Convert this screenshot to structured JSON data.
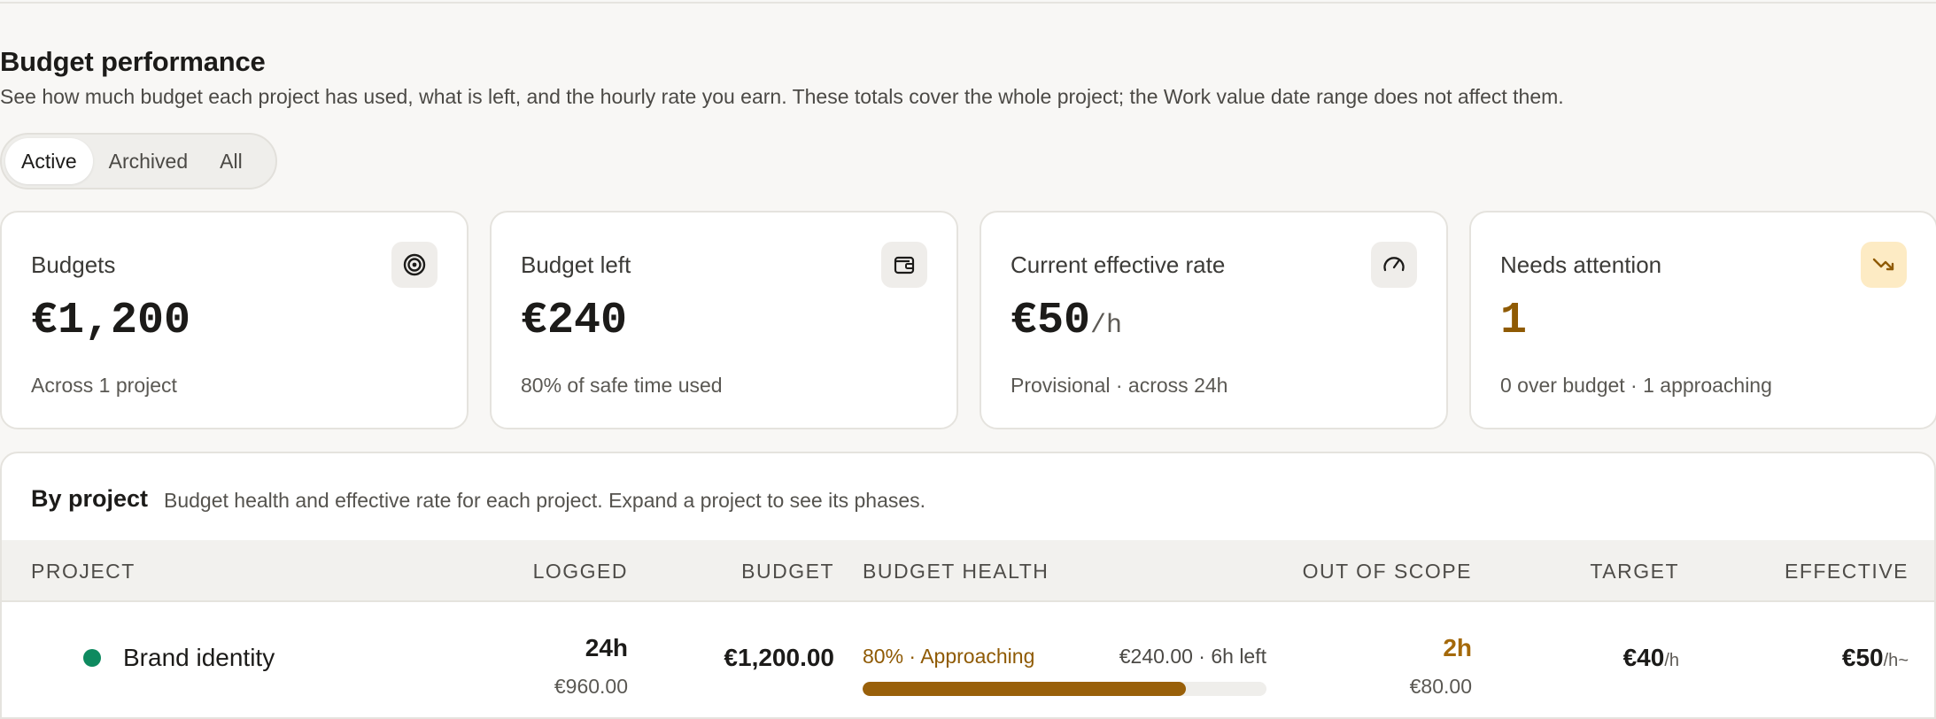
{
  "header": {
    "title": "Budget performance",
    "description": "See how much budget each project has used, what is left, and the hourly rate you earn. These totals cover the whole project; the Work value date range does not affect them."
  },
  "filter_tabs": [
    "Active",
    "Archived",
    "All"
  ],
  "filter_selected": "Active",
  "cards": [
    {
      "label": "Budgets",
      "value": "€1,200",
      "unit": "",
      "sub": "Across 1 project",
      "icon": "target-icon"
    },
    {
      "label": "Budget left",
      "value": "€240",
      "unit": "",
      "sub": "80% of safe time used",
      "icon": "wallet-icon"
    },
    {
      "label": "Current effective rate",
      "value": "€50",
      "unit": "/h",
      "sub": "Provisional · across 24h",
      "icon": "gauge-icon"
    },
    {
      "label": "Needs attention",
      "value": "1",
      "unit": "",
      "sub": "0 over budget · 1 approaching",
      "icon": "trending-down-icon"
    }
  ],
  "by_project": {
    "title": "By project",
    "description": "Budget health and effective rate for each project. Expand a project to see its phases.",
    "columns": [
      "PROJECT",
      "LOGGED",
      "BUDGET",
      "BUDGET HEALTH",
      "OUT OF SCOPE",
      "TARGET",
      "EFFECTIVE"
    ],
    "rows": [
      {
        "name": "Brand identity",
        "logged_hours": "24h",
        "logged_value": "€960.00",
        "budget": "€1,200.00",
        "health_label": "80% · Approaching",
        "health_left": "€240.00 · 6h left",
        "health_percent": 80,
        "out_of_scope_hours": "2h",
        "out_of_scope_value": "€80.00",
        "target": "€40",
        "target_unit": "/h",
        "effective": "€50",
        "effective_unit": "/h",
        "effective_suffix": "~"
      }
    ]
  },
  "colors": {
    "warning": "#8f5a04",
    "bar_fill": "#99600a",
    "project_dot": "#0e8a5f"
  }
}
